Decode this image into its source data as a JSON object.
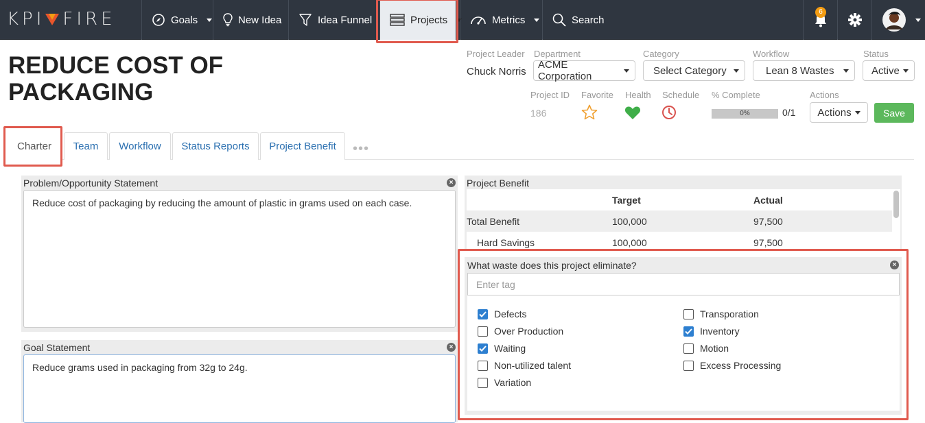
{
  "nav": {
    "logo_left": "KPI",
    "logo_right": "FIRE",
    "goals": "Goals",
    "new_idea": "New Idea",
    "idea_funnel": "Idea Funnel",
    "projects": "Projects",
    "metrics": "Metrics",
    "search": "Search",
    "notification_count": "6"
  },
  "project": {
    "title": "REDUCE COST OF PACKAGING",
    "leader_label": "Project Leader",
    "leader": "Chuck Norris",
    "department_label": "Department",
    "department": "ACME Corporation",
    "category_label": "Category",
    "category": "Select Category",
    "workflow_label": "Workflow",
    "workflow": "Lean 8 Wastes",
    "status_label": "Status",
    "status": "Active",
    "id_label": "Project ID",
    "id": "186",
    "favorite_label": "Favorite",
    "health_label": "Health",
    "schedule_label": "Schedule",
    "complete_label": "% Complete",
    "complete_value": "0%",
    "complete_fraction": 0,
    "tasks": "0/1",
    "actions_label": "Actions",
    "actions_button": "Actions",
    "save": "Save"
  },
  "tabs": [
    "Charter",
    "Team",
    "Workflow",
    "Status Reports",
    "Project Benefit"
  ],
  "problem": {
    "title": "Problem/Opportunity Statement",
    "text": "Reduce cost of packaging by reducing the amount of plastic in grams used on each case."
  },
  "goal": {
    "title": "Goal Statement",
    "text": "Reduce grams used in packaging from 32g to 24g."
  },
  "benefit": {
    "title": "Project Benefit",
    "col_target": "Target",
    "col_actual": "Actual",
    "rows": [
      {
        "label": "Total Benefit",
        "target": "100,000",
        "actual": "97,500"
      },
      {
        "label": "Hard Savings",
        "target": "100,000",
        "actual": "97,500"
      }
    ]
  },
  "waste": {
    "title": "What waste does this project eliminate?",
    "placeholder": "Enter tag",
    "items": [
      {
        "label": "Defects",
        "checked": true
      },
      {
        "label": "Over Production",
        "checked": false
      },
      {
        "label": "Waiting",
        "checked": true
      },
      {
        "label": "Non-utilized talent",
        "checked": false
      },
      {
        "label": "Variation",
        "checked": false
      },
      {
        "label": "Transporation",
        "checked": false
      },
      {
        "label": "Inventory",
        "checked": true
      },
      {
        "label": "Motion",
        "checked": false
      },
      {
        "label": "Excess Processing",
        "checked": false
      }
    ]
  },
  "colors": {
    "nav_bg": "#2f3640",
    "highlight": "#e05a4e",
    "link": "#2a6fb0",
    "save": "#5cb85c",
    "health": "#3fae49",
    "favorite": "#f0a030",
    "schedule": "#d9534f",
    "checkbox": "#2d7fd0"
  }
}
